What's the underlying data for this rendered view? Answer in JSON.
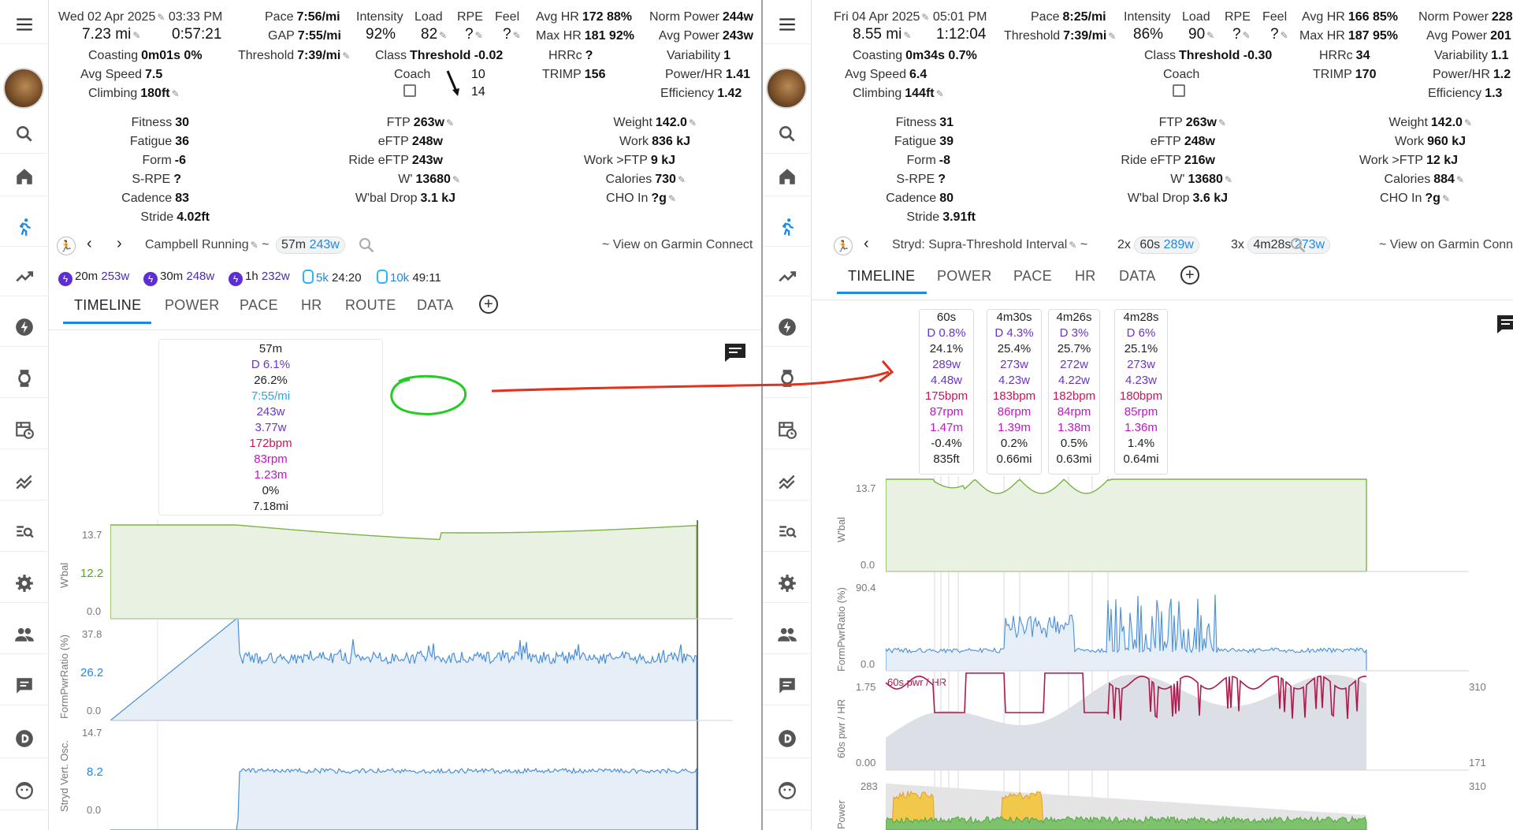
{
  "left": {
    "date": "Wed 02 Apr 2025",
    "time": "03:33 PM",
    "distance": "7.23 mi",
    "duration": "0:57:21",
    "stats_col1": [
      {
        "label": "Coasting",
        "value": "0m01s 0%"
      },
      {
        "label": "Avg Speed",
        "value": "7.5"
      },
      {
        "label": "Climbing",
        "value": "180ft"
      }
    ],
    "pace_label": "Pace",
    "pace": "7:56/mi",
    "gap_label": "GAP",
    "gap": "7:55/mi",
    "threshold_label": "Threshold",
    "threshold": "7:39/mi",
    "intensity_label": "Intensity",
    "intensity": "92%",
    "load_label": "Load",
    "load": "82",
    "rpe_label": "RPE",
    "rpe": "?",
    "feel_label": "Feel",
    "feel": "?",
    "class_label": "Class",
    "class_value": "Threshold -0.02",
    "coach_label": "Coach",
    "coach_hr1": "10",
    "coach_hr2": "14",
    "hr_stats": [
      {
        "label": "Avg HR",
        "value": "172 88%"
      },
      {
        "label": "Max HR",
        "value": "181 92%"
      },
      {
        "label": "HRRc",
        "value": "?"
      },
      {
        "label": "TRIMP",
        "value": "156"
      }
    ],
    "power_stats": [
      {
        "label": "Norm Power",
        "value": "244w"
      },
      {
        "label": "Avg Power",
        "value": "243w"
      },
      {
        "label": "Variability",
        "value": "1"
      },
      {
        "label": "Power/HR",
        "value": "1.41"
      },
      {
        "label": "Efficiency",
        "value": "1.42"
      }
    ],
    "fitness": [
      {
        "label": "Fitness",
        "value": "30"
      },
      {
        "label": "Fatigue",
        "value": "36"
      },
      {
        "label": "Form",
        "value": "-6"
      },
      {
        "label": "S-RPE",
        "value": "?"
      },
      {
        "label": "Cadence",
        "value": "83"
      },
      {
        "label": "Stride",
        "value": "4.02ft"
      }
    ],
    "ftp": [
      {
        "label": "FTP",
        "value": "263w"
      },
      {
        "label": "eFTP",
        "value": "248w"
      },
      {
        "label": "Ride eFTP",
        "value": "243w"
      },
      {
        "label": "W'",
        "value": "13680"
      },
      {
        "label": "W'bal Drop",
        "value": "3.1 kJ"
      }
    ],
    "weight": [
      {
        "label": "Weight",
        "value": "142.0"
      },
      {
        "label": "Work",
        "value": "836 kJ"
      },
      {
        "label": "Work >FTP",
        "value": "9 kJ"
      },
      {
        "label": "Calories",
        "value": "730"
      },
      {
        "label": "CHO In",
        "value": "?g"
      }
    ],
    "activity_name": "Campbell Running",
    "tilde": "~",
    "interval_pill_time": "57m",
    "interval_pill_power": "243w",
    "garmin_link": "~ View on Garmin Connect",
    "peaks": [
      {
        "time": "20m",
        "val": "253w"
      },
      {
        "time": "30m",
        "val": "248w"
      },
      {
        "time": "1h",
        "val": "232w"
      }
    ],
    "runs": [
      {
        "dist": "5k",
        "val": "24:20"
      },
      {
        "dist": "10k",
        "val": "49:11"
      }
    ],
    "tabs": [
      "TIMELINE",
      "POWER",
      "PACE",
      "HR",
      "ROUTE",
      "DATA"
    ],
    "interval_box": [
      "57m",
      "D 6.1%",
      "26.2%",
      "7:55/mi",
      "243w",
      "3.77w",
      "172bpm",
      "83rpm",
      "1.23m",
      "0%",
      "7.18mi"
    ],
    "wbal": {
      "label": "W'bal",
      "top": "13.7",
      "mid": "12.2",
      "bottom": "0.0"
    },
    "fpr": {
      "label": "FormPwrRatio (%)",
      "top": "37.8",
      "mid": "26.2",
      "bottom": "0.0"
    },
    "svo": {
      "label": "Stryd Vert. Osc.",
      "top": "14.7",
      "mid": "8.2",
      "bottom": "0.0"
    }
  },
  "right": {
    "date": "Fri 04 Apr 2025",
    "time": "05:01 PM",
    "distance": "8.55 mi",
    "duration": "1:12:04",
    "stats_col1": [
      {
        "label": "Coasting",
        "value": "0m34s 0.7%"
      },
      {
        "label": "Avg Speed",
        "value": "6.4"
      },
      {
        "label": "Climbing",
        "value": "144ft"
      }
    ],
    "pace_label": "Pace",
    "pace": "8:25/mi",
    "threshold_label": "Threshold",
    "threshold": "7:39/mi",
    "intensity_label": "Intensity",
    "intensity": "86%",
    "load_label": "Load",
    "load": "90",
    "rpe_label": "RPE",
    "rpe": "?",
    "feel_label": "Feel",
    "feel": "?",
    "class_label": "Class",
    "class_value": "Threshold -0.30",
    "coach_label": "Coach",
    "hr_stats": [
      {
        "label": "Avg HR",
        "value": "166 85%"
      },
      {
        "label": "Max HR",
        "value": "187 95%"
      },
      {
        "label": "HRRc",
        "value": "34"
      },
      {
        "label": "TRIMP",
        "value": "170"
      }
    ],
    "power_stats": [
      {
        "label": "Norm Power",
        "value": "228"
      },
      {
        "label": "Avg Power",
        "value": "201"
      },
      {
        "label": "Variability",
        "value": "1.1"
      },
      {
        "label": "Power/HR",
        "value": "1.2"
      },
      {
        "label": "Efficiency",
        "value": "1.3"
      }
    ],
    "fitness": [
      {
        "label": "Fitness",
        "value": "31"
      },
      {
        "label": "Fatigue",
        "value": "39"
      },
      {
        "label": "Form",
        "value": "-8"
      },
      {
        "label": "S-RPE",
        "value": "?"
      },
      {
        "label": "Cadence",
        "value": "80"
      },
      {
        "label": "Stride",
        "value": "3.91ft"
      }
    ],
    "ftp": [
      {
        "label": "FTP",
        "value": "263w"
      },
      {
        "label": "eFTP",
        "value": "248w"
      },
      {
        "label": "Ride eFTP",
        "value": "216w"
      },
      {
        "label": "W'",
        "value": "13680"
      },
      {
        "label": "W'bal Drop",
        "value": "3.6 kJ"
      }
    ],
    "weight": [
      {
        "label": "Weight",
        "value": "142.0"
      },
      {
        "label": "Work",
        "value": "960 kJ"
      },
      {
        "label": "Work >FTP",
        "value": "12 kJ"
      },
      {
        "label": "Calories",
        "value": "884"
      },
      {
        "label": "CHO In",
        "value": "?g"
      }
    ],
    "activity_name": "Stryd: Supra-Threshold Interval",
    "tilde": "~",
    "pill1_count": "2x",
    "pill1_time": "60s",
    "pill1_power": "289w",
    "pill2_count": "3x",
    "pill2_time": "4m28s",
    "pill2_power": "273w",
    "garmin_link": "~ View on Garmin Conne",
    "tabs": [
      "TIMELINE",
      "POWER",
      "PACE",
      "HR",
      "DATA"
    ],
    "interval_boxes": [
      [
        "60s",
        "D 0.8%",
        "24.1%",
        "289w",
        "4.48w",
        "175bpm",
        "87rpm",
        "1.47m",
        "-0.4%",
        "835ft"
      ],
      [
        "4m30s",
        "D 4.3%",
        "25.4%",
        "273w",
        "4.23w",
        "183bpm",
        "86rpm",
        "1.39m",
        "0.2%",
        "0.66mi"
      ],
      [
        "4m26s",
        "D 3%",
        "25.7%",
        "272w",
        "4.22w",
        "182bpm",
        "84rpm",
        "1.38m",
        "0.5%",
        "0.63mi"
      ],
      [
        "4m28s",
        "D 6%",
        "25.1%",
        "273w",
        "4.23w",
        "180bpm",
        "85rpm",
        "1.36m",
        "1.4%",
        "0.64mi"
      ]
    ],
    "wbal": {
      "label": "W'bal",
      "top": "13.7",
      "bottom": "0.0"
    },
    "fpr": {
      "label": "FormPwrRatio (%)",
      "top": "90.4",
      "bottom": "0.0"
    },
    "pwrhr": {
      "label": "60s pwr / HR",
      "legend": "60s pwr / HR",
      "top": "1.75",
      "bottom": "0.00",
      "right_top": "310",
      "right_bottom": "171"
    },
    "power": {
      "label": "Power",
      "top": "283",
      "right_top": "310"
    }
  },
  "sidebar_icons": [
    "menu-icon",
    "search-icon",
    "home-icon",
    "run-icon",
    "trend-icon",
    "bolt-icon",
    "watch-icon",
    "calendar-clock-icon",
    "chart-lines-icon",
    "search-list-icon",
    "gear-icon",
    "people-icon",
    "chat-icon",
    "d-logo-icon",
    "face-icon"
  ],
  "colors": {
    "accent": "#1e88e5",
    "purple": "#5b2fd4",
    "wbal_fill": "#e8f1e2",
    "wbal_line": "#7cb342",
    "fpr_fill": "#e6eef8",
    "fpr_line": "#4a90d9",
    "hr_line": "#b0174a",
    "annotation_red": "#e0321c",
    "annotation_green": "#22cc22"
  }
}
